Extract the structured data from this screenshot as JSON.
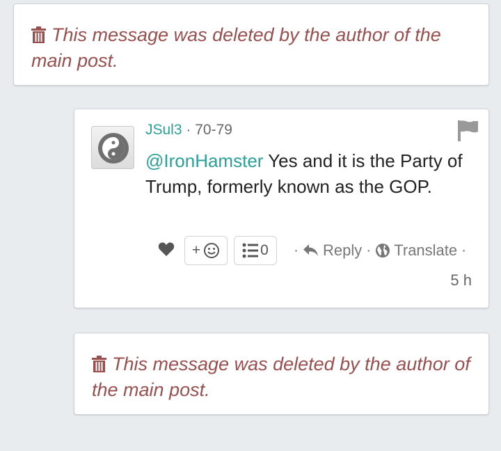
{
  "deleted_messages": [
    {
      "text": "This message was deleted by the author of the main post."
    },
    {
      "text": "This message was deleted by the author of the main post."
    }
  ],
  "reply": {
    "author": "JSul3",
    "separator": "·",
    "age_range": "70-79",
    "mention": "@IronHamster",
    "body": " Yes and it is the Party of Trump, formerly known as the GOP.",
    "emoji_plus": "+",
    "list_count": "0",
    "reply_label": "Reply",
    "translate_label": "Translate",
    "timestamp": "5 h"
  },
  "colors": {
    "deleted_text": "#9a4f4f",
    "accent": "#2aa198",
    "background": "#e9ecef"
  },
  "icons": [
    "trash-icon",
    "avatar-yin-yang-icon",
    "flag-icon",
    "heart-icon",
    "emoji-icon",
    "list-icon",
    "reply-arrow-icon",
    "globe-icon"
  ]
}
